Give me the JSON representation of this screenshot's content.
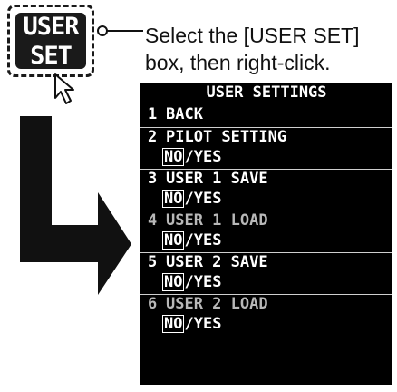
{
  "user_set_box": {
    "line1": "USER",
    "line2": "SET"
  },
  "callout": {
    "line1": "Select the [USER SET]",
    "line2": "box, then right-click."
  },
  "menu": {
    "title": "USER SETTINGS",
    "items": [
      {
        "number": "1",
        "label": "BACK",
        "dimmed": false
      },
      {
        "number": "2",
        "label": "PILOT SETTING",
        "dimmed": false,
        "options": {
          "no": "NO",
          "slash": "/",
          "yes": "YES",
          "selected": "NO"
        }
      },
      {
        "number": "3",
        "label": "USER 1 SAVE",
        "dimmed": false,
        "options": {
          "no": "NO",
          "slash": "/",
          "yes": "YES",
          "selected": "NO"
        }
      },
      {
        "number": "4",
        "label": "USER 1 LOAD",
        "dimmed": true,
        "options": {
          "no": "NO",
          "slash": "/",
          "yes": "YES",
          "selected": "NO"
        }
      },
      {
        "number": "5",
        "label": "USER 2 SAVE",
        "dimmed": false,
        "options": {
          "no": "NO",
          "slash": "/",
          "yes": "YES",
          "selected": "NO"
        }
      },
      {
        "number": "6",
        "label": "USER 2 LOAD",
        "dimmed": true,
        "options": {
          "no": "NO",
          "slash": "/",
          "yes": "YES",
          "selected": "NO"
        }
      }
    ]
  },
  "icons": {
    "cursor": "mouse-pointer-icon",
    "arrow": "down-right-arrow-icon"
  },
  "colors": {
    "menu_background": "#000000",
    "menu_text": "#ffffff",
    "dimmed_text": "#b8b8b8",
    "arrow": "#111111"
  }
}
